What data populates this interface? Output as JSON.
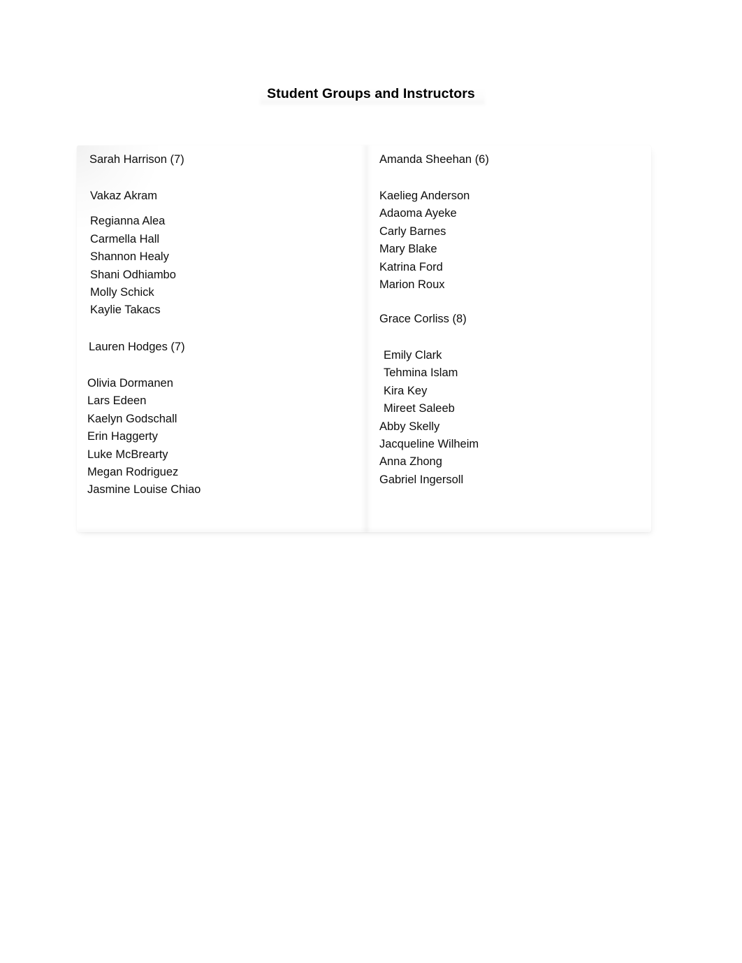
{
  "document": {
    "title": "Student Groups and Instructors"
  },
  "colors": {
    "page_background": "#ffffff",
    "panel_background": "#ffffff",
    "text": "#0d0d0d"
  },
  "columns": {
    "left": {
      "groups": [
        {
          "instructor": "Sarah Harrison",
          "count": 7,
          "header": "Sarah Harrison (7)",
          "students": [
            "Vakaz Akram",
            "Regianna Alea",
            "Carmella Hall",
            "Shannon Healy",
            "Shani Odhiambo",
            "Molly Schick",
            "Kaylie Takacs"
          ]
        },
        {
          "instructor": "Lauren Hodges",
          "count": 7,
          "header": "Lauren Hodges (7)",
          "students": [
            "Olivia Dormanen",
            "Lars Edeen",
            "Kaelyn Godschall",
            "Erin Haggerty",
            "Luke McBrearty",
            "Megan Rodriguez",
            "Jasmine Louise Chiao"
          ]
        }
      ]
    },
    "right": {
      "groups": [
        {
          "instructor": "Amanda Sheehan",
          "count": 6,
          "header": "Amanda Sheehan (6)",
          "students": [
            "Kaelieg Anderson",
            "Adaoma Ayeke",
            "Carly Barnes",
            "Mary Blake",
            "Katrina Ford",
            "Marion Roux"
          ]
        },
        {
          "instructor": "Grace Corliss",
          "count": 8,
          "header": "Grace Corliss (8)",
          "students": [
            "Emily Clark",
            "Tehmina Islam",
            "Kira Key",
            "Mireet Saleeb",
            "Abby Skelly",
            "Jacqueline Wilheim",
            "Anna Zhong",
            "Gabriel Ingersoll"
          ]
        }
      ]
    }
  }
}
